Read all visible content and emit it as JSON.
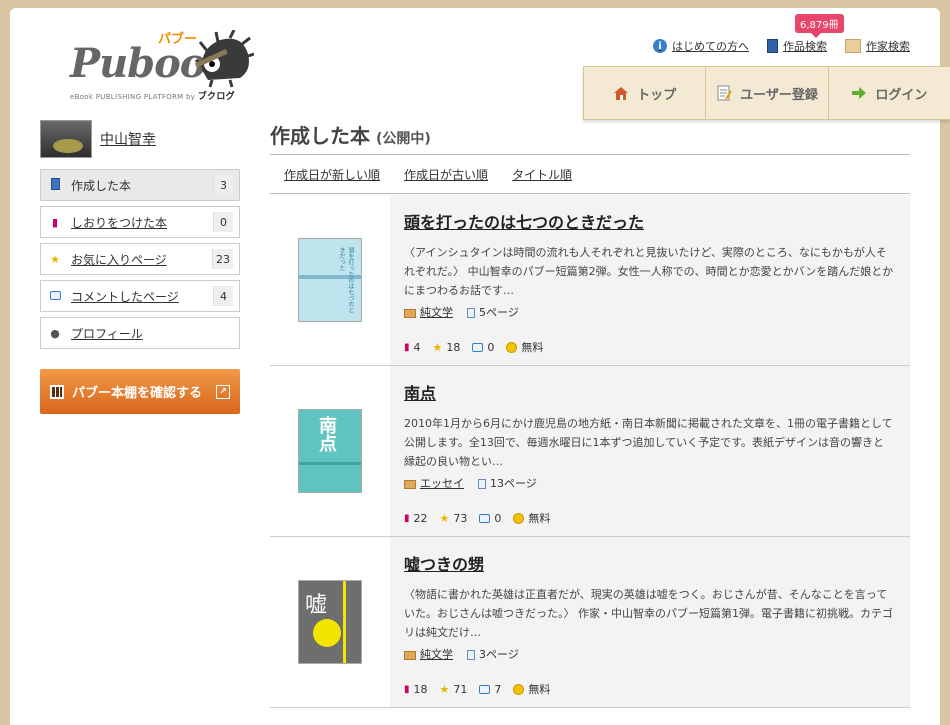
{
  "header": {
    "logo_text": "Puboo",
    "logo_kana": "パブー",
    "logo_sub": "eBook PUBLISHING PLATFORM by",
    "logo_brand": "ブクログ",
    "links": [
      {
        "label": "はじめての方へ",
        "icon": "info-icon"
      },
      {
        "label": "作品検索",
        "icon": "book-icon",
        "badge": "6,879冊"
      },
      {
        "label": "作家検索",
        "icon": "author-icon"
      }
    ],
    "nav": [
      {
        "label": "トップ",
        "icon": "home-icon"
      },
      {
        "label": "ユーザー登録",
        "icon": "register-icon"
      },
      {
        "label": "ログイン",
        "icon": "arrow-right-icon"
      }
    ]
  },
  "sidebar": {
    "user_name": "中山智幸",
    "items": [
      {
        "label": "作成した本",
        "count": "3",
        "icon": "book-icon",
        "active": true
      },
      {
        "label": "しおりをつけた本",
        "count": "0",
        "icon": "bookmark-icon"
      },
      {
        "label": "お気に入りページ",
        "count": "23",
        "icon": "star-icon"
      },
      {
        "label": "コメントしたページ",
        "count": "4",
        "icon": "comment-icon"
      },
      {
        "label": "プロフィール",
        "count": "",
        "icon": "person-icon"
      }
    ],
    "shelf_button": "パブー本棚を確認する"
  },
  "main": {
    "title": "作成した本",
    "title_sub": "(公開中)",
    "sort_links": [
      "作成日が新しい順",
      "作成日が古い順",
      "タイトル順"
    ],
    "books": [
      {
        "title": "頭を打ったのは七つのときだった",
        "description": "〈アインシュタインは時間の流れも人それぞれと見抜いたけど、実際のところ、なにもかもが人それぞれだ。〉 中山智幸のパブー短篇第2弾。女性一人称での、時間とか恋愛とかバンを踏んだ娘とかにまつわるお話です…",
        "genre": "純文学",
        "pages": "5ページ",
        "bookmarks": "4",
        "favorites": "18",
        "comments": "0",
        "price": "無料",
        "cover": {
          "bg": "#bfe4ee",
          "text": "頭を打ったのは七つのときだった",
          "color": "#2f7f9a",
          "band": "#7fb9d0"
        }
      },
      {
        "title": "南点",
        "description": "2010年1月から6月にかけ鹿児島の地方紙・南日本新聞に掲載された文章を、1冊の電子書籍として公開します。全13回で、毎週水曜日に1本ずつ追加していく予定です。表紙デザインは音の響きと縁起の良い物とい…",
        "genre": "エッセイ",
        "pages": "13ページ",
        "bookmarks": "22",
        "favorites": "73",
        "comments": "0",
        "price": "無料",
        "cover": {
          "bg": "#5fc4c0",
          "text": "南点",
          "color": "#ffffff",
          "band": "#3aa6a2"
        }
      },
      {
        "title": "嘘つきの甥",
        "description": "〈物語に書かれた英雄は正直者だが、現実の英雄は嘘をつく。おじさんが昔、そんなことを言っていた。おじさんは嘘つきだった。〉 作家・中山智幸のパブー短篇第1弾。電子書籍に初挑戦。カテゴリは純文だけ…",
        "genre": "純文学",
        "pages": "3ページ",
        "bookmarks": "18",
        "favorites": "71",
        "comments": "7",
        "price": "無料",
        "cover": {
          "bg": "#6e6e6e",
          "text": "嘘",
          "color": "#ffffff",
          "band": "#f2e600"
        }
      }
    ]
  }
}
